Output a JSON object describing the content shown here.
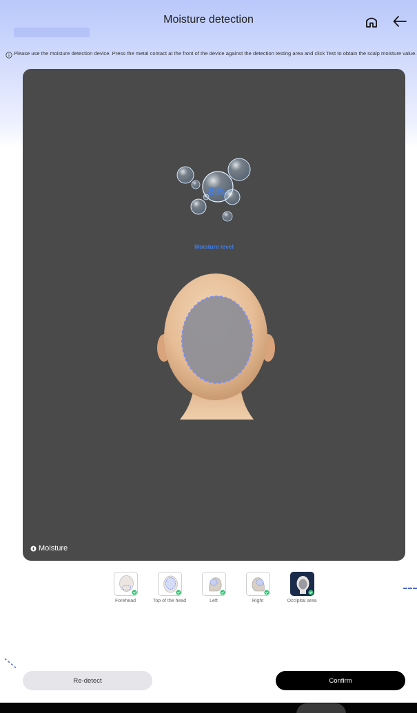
{
  "header": {
    "title": "Moisture detection",
    "home_icon": "home-icon",
    "back_icon": "arrow-left-icon"
  },
  "info": {
    "icon": "info-circle-icon",
    "text": "Please use the moisture detection device. Press the metal contact at the front of the device against the detection testing area and click Test to obtain the scalp moisture value."
  },
  "reading": {
    "value": "8%",
    "label": "Moisture level",
    "accent_color": "#3f7de6"
  },
  "legend": {
    "label": "Moisture"
  },
  "areas": [
    {
      "label": "Forehead",
      "checked": true,
      "selected": false
    },
    {
      "label": "Top of the head",
      "checked": true,
      "selected": false
    },
    {
      "label": "Left",
      "checked": true,
      "selected": false
    },
    {
      "label": "Right",
      "checked": true,
      "selected": false
    },
    {
      "label": "Occipital area",
      "checked": true,
      "selected": true
    }
  ],
  "actions": {
    "redetect_label": "Re-detect",
    "confirm_label": "Confirm"
  },
  "colors": {
    "panel_bg": "#4a4a4a",
    "check_green": "#2fbf71",
    "dashed_outline": "#7d8ff0"
  }
}
